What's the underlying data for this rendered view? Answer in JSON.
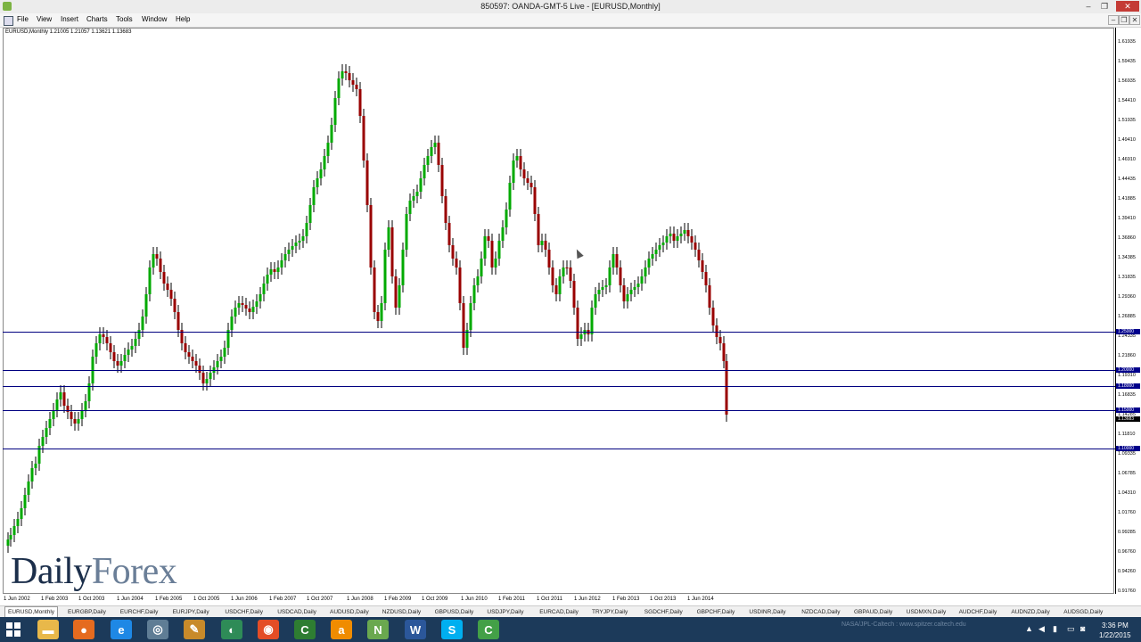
{
  "window": {
    "title": "850597: OANDA-GMT-5 Live - [EURUSD,Monthly]",
    "controls": [
      "–",
      "❐",
      "✕"
    ]
  },
  "menu": [
    "File",
    "View",
    "Insert",
    "Charts",
    "Tools",
    "Window",
    "Help"
  ],
  "chart": {
    "symbol_info": "EURUSD,Monthly  1.21005 1.21057 1.13621 1.13683",
    "price_labels": [
      "1.61935",
      "1.59435",
      "1.56935",
      "1.54410",
      "1.51935",
      "1.49410",
      "1.46910",
      "1.44435",
      "1.41885",
      "1.39410",
      "1.36860",
      "1.34385",
      "1.31835",
      "1.29360",
      "1.26885",
      "1.24335",
      "1.21860",
      "1.19310",
      "1.16835",
      "1.14285",
      "1.11810",
      "1.09335",
      "1.06785",
      "1.04310",
      "1.01760",
      "0.99285",
      "0.96760",
      "0.94260",
      "0.91760"
    ],
    "level_tags": [
      "1.25000",
      "1.20000",
      "1.18000",
      "1.15000",
      "1.10000"
    ],
    "current_price_tag": "1.13683",
    "date_labels": [
      "1 Jun 2002",
      "1 Feb 2003",
      "1 Oct 2003",
      "1 Jun 2004",
      "1 Feb 2005",
      "1 Oct 2005",
      "1 Jun 2006",
      "1 Feb 2007",
      "1 Oct 2007",
      "1 Jun 2008",
      "1 Feb 2009",
      "1 Oct 2009",
      "1 Jun 2010",
      "1 Feb 2011",
      "1 Oct 2011",
      "1 Jun 2012",
      "1 Feb 2013",
      "1 Oct 2013",
      "1 Jun 2014"
    ],
    "bull_color": "#00aa00",
    "bear_color": "#990000",
    "level_color": "#000080"
  },
  "tabs": [
    "EURUSD,Monthly",
    "EURGBP,Daily",
    "EURCHF,Daily",
    "EURJPY,Daily",
    "USDCHF,Daily",
    "USDCAD,Daily",
    "AUDUSD,Daily",
    "NZDUSD,Daily",
    "GBPUSD,Daily",
    "USDJPY,Daily",
    "EURCAD,Daily",
    "TRYJPY,Daily",
    "SGDCHF,Daily",
    "GBPCHF,Daily",
    "USDINR,Daily",
    "NZDCAD,Daily",
    "GBPAUD,Daily",
    "USDMXN,Daily",
    "AUDCHF,Daily",
    "AUDNZD,Daily",
    "AUDSGD,Daily"
  ],
  "brand": {
    "part1": "Daily",
    "part2": "Forex"
  },
  "taskbar": {
    "time": "3:36 PM",
    "date": "1/22/2015",
    "watermark": "NASA/JPL-Caltech : www.spitzer.caltech.edu",
    "apps": [
      {
        "name": "explorer-icon",
        "glyph": "▬",
        "color": "#e8b84a"
      },
      {
        "name": "firefox-icon",
        "glyph": "●",
        "color": "#e56b1f"
      },
      {
        "name": "ie-icon",
        "glyph": "e",
        "color": "#1e88e5"
      },
      {
        "name": "settings-app-icon",
        "glyph": "◎",
        "color": "#5f7d95"
      },
      {
        "name": "tools-app-icon",
        "glyph": "✎",
        "color": "#c88a2a"
      },
      {
        "name": "green-app-icon",
        "glyph": "◐",
        "color": "#2e8b57"
      },
      {
        "name": "chrome-icon",
        "glyph": "◉",
        "color": "#e44d26"
      },
      {
        "name": "camtasia-icon",
        "glyph": "C",
        "color": "#2e7d32"
      },
      {
        "name": "amazon-icon",
        "glyph": "a",
        "color": "#f08c00"
      },
      {
        "name": "trading-app-icon",
        "glyph": "N",
        "color": "#6aa84f"
      },
      {
        "name": "word-icon",
        "glyph": "W",
        "color": "#2b579a"
      },
      {
        "name": "skype-icon",
        "glyph": "S",
        "color": "#00aff0"
      },
      {
        "name": "camtasia-recorder-icon",
        "glyph": "C",
        "color": "#43a047"
      }
    ]
  }
}
